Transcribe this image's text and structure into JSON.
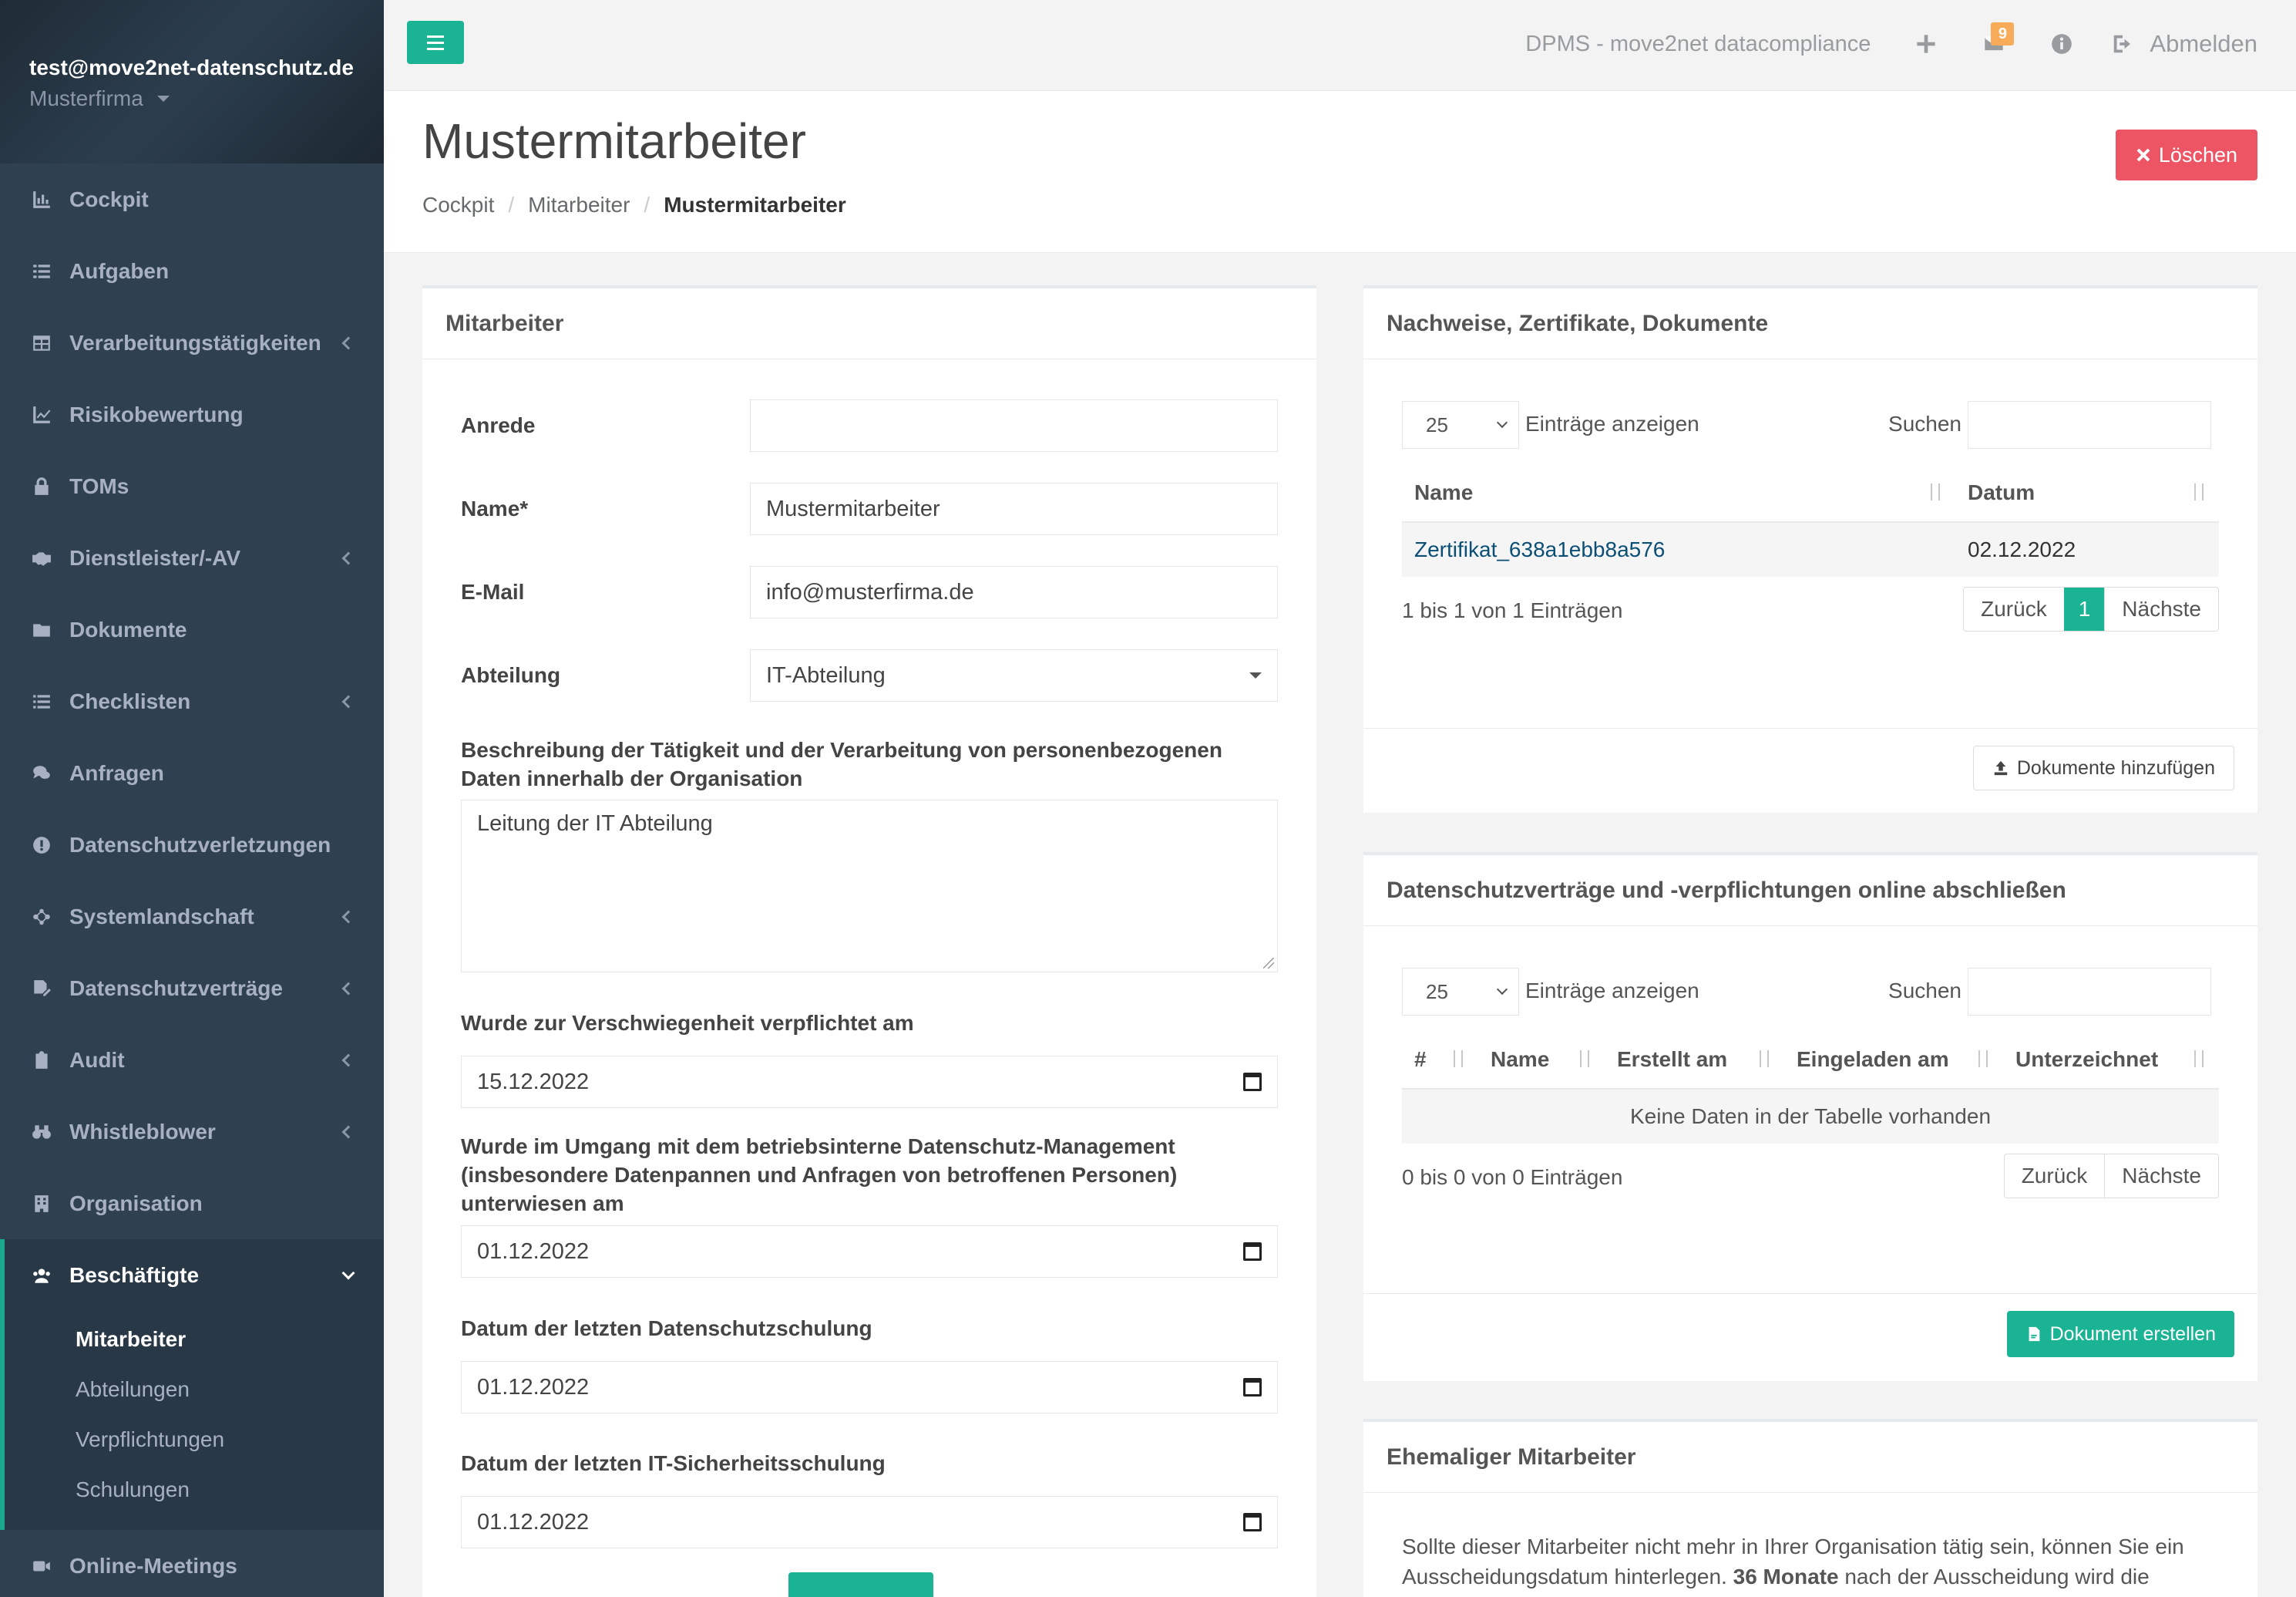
{
  "sidebar": {
    "email": "test@move2net-datenschutz.de",
    "company": "Musterfirma",
    "items": [
      {
        "label": "Cockpit",
        "icon": "chart-icon",
        "has_children": false
      },
      {
        "label": "Aufgaben",
        "icon": "tasks-icon",
        "has_children": false
      },
      {
        "label": "Verarbeitungstätigkeiten",
        "icon": "table-icon",
        "has_children": true
      },
      {
        "label": "Risikobewertung",
        "icon": "line-chart-icon",
        "has_children": false
      },
      {
        "label": "TOMs",
        "icon": "lock-icon",
        "has_children": false
      },
      {
        "label": "Dienstleister/-AV",
        "icon": "handshake-icon",
        "has_children": true
      },
      {
        "label": "Dokumente",
        "icon": "folder-icon",
        "has_children": false
      },
      {
        "label": "Checklisten",
        "icon": "list-icon",
        "has_children": true
      },
      {
        "label": "Anfragen",
        "icon": "comments-icon",
        "has_children": false
      },
      {
        "label": "Datenschutzverletzungen",
        "icon": "exclamation-circle-icon",
        "has_children": false
      },
      {
        "label": "Systemlandschaft",
        "icon": "network-icon",
        "has_children": true
      },
      {
        "label": "Datenschutzverträge",
        "icon": "file-signature-icon",
        "has_children": true
      },
      {
        "label": "Audit",
        "icon": "clipboard-icon",
        "has_children": true
      },
      {
        "label": "Whistleblower",
        "icon": "binoculars-icon",
        "has_children": true
      },
      {
        "label": "Organisation",
        "icon": "building-icon",
        "has_children": false
      }
    ],
    "active_item": {
      "label": "Beschäftigte",
      "icon": "users-icon"
    },
    "subitems": [
      {
        "label": "Mitarbeiter",
        "current": true
      },
      {
        "label": "Abteilungen",
        "current": false
      },
      {
        "label": "Verpflichtungen",
        "current": false
      },
      {
        "label": "Schulungen",
        "current": false
      }
    ],
    "after_items": [
      {
        "label": "Online-Meetings",
        "icon": "video-icon"
      }
    ]
  },
  "topbar": {
    "app_title": "DPMS - move2net datacompliance",
    "mail_badge": "9",
    "logout_label": "Abmelden"
  },
  "header": {
    "title": "Mustermitarbeiter",
    "breadcrumb": [
      "Cockpit",
      "Mitarbeiter",
      "Mustermitarbeiter"
    ],
    "delete_label": "Löschen"
  },
  "employee_panel": {
    "title": "Mitarbeiter",
    "salutation_label": "Anrede",
    "salutation_value": "",
    "name_label": "Name*",
    "name_value": "Mustermitarbeiter",
    "email_label": "E-Mail",
    "email_value": "info@musterfirma.de",
    "department_label": "Abteilung",
    "department_value": "IT-Abteilung",
    "description_label": "Beschreibung der Tätigkeit und der Verarbeitung von personenbezogenen Daten innerhalb der Organisation",
    "description_value": "Leitung der IT Abteilung",
    "confidentiality_label": "Wurde zur Verschwiegenheit verpflichtet am",
    "confidentiality_value": "15.12.2022",
    "instruction_label": "Wurde im Umgang mit dem betriebsinterne Datenschutz-Management (insbesondere Datenpannen und Anfragen von betroffenen Personen) unterwiesen am",
    "instruction_value": "01.12.2022",
    "privacy_training_label": "Datum der letzten Datenschutzschulung",
    "privacy_training_value": "01.12.2022",
    "security_training_label": "Datum der letzten IT-Sicherheitsschulung",
    "security_training_value": "01.12.2022"
  },
  "documents_panel": {
    "title": "Nachweise, Zertifikate, Dokumente",
    "page_length": "25",
    "length_label": "Einträge anzeigen",
    "search_label": "Suchen",
    "columns": [
      "Name",
      "Datum"
    ],
    "rows": [
      {
        "name": "Zertifikat_638a1ebb8a576",
        "date": "02.12.2022"
      }
    ],
    "info": "1 bis 1 von 1 Einträgen",
    "prev_label": "Zurück",
    "current_page": "1",
    "next_label": "Nächste",
    "add_label": "Dokumente hinzufügen"
  },
  "contracts_panel": {
    "title": "Datenschutzverträge und -verpflichtungen online abschließen",
    "page_length": "25",
    "length_label": "Einträge anzeigen",
    "search_label": "Suchen",
    "columns": [
      "#",
      "Name",
      "Erstellt am",
      "Eingeladen am",
      "Unterzeichnet"
    ],
    "empty_text": "Keine Daten in der Tabelle vorhanden",
    "info": "0 bis 0 von 0 Einträgen",
    "prev_label": "Zurück",
    "next_label": "Nächste",
    "create_label": "Dokument erstellen"
  },
  "former_panel": {
    "title": "Ehemaliger Mitarbeiter",
    "text_start": "Sollte dieser Mitarbeiter nicht mehr in Ihrer Organisation tätig sein, können Sie ein Ausscheidungsdatum hinterlegen.",
    "text_bold": "36 Monate",
    "text_end": "nach der Ausscheidung wird die Aufgabe"
  },
  "colors": {
    "sidebar_bg": "#2f4050",
    "accent": "#1ab394",
    "danger": "#ed5565",
    "badge": "#f8ac59"
  }
}
